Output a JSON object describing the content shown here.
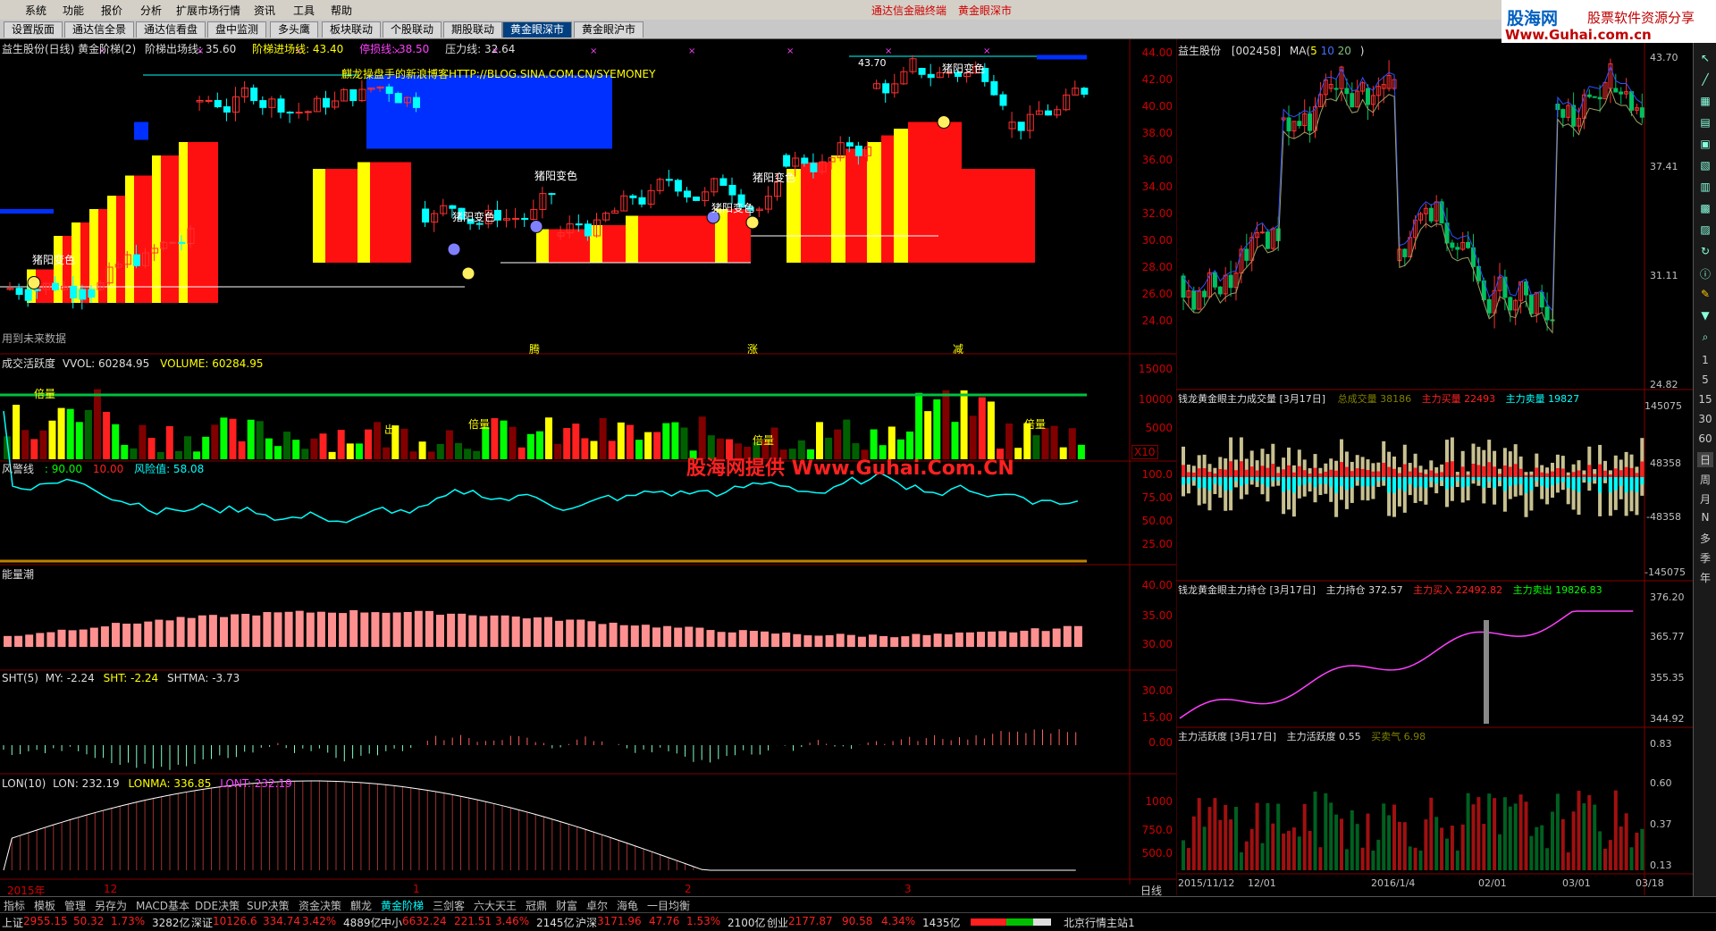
{
  "menu": {
    "items": [
      "系统",
      "功能",
      "报价",
      "分析",
      "扩展市场行情",
      "资讯",
      "工具",
      "帮助"
    ],
    "center_links": [
      "通达信金融终端",
      "黄金眼深市"
    ]
  },
  "brand": {
    "line1": "股海网",
    "line2": "股票软件资源分享",
    "line3": "Www.Guhai.com.cn"
  },
  "tabs": [
    "设置版面",
    "通达信全景",
    "通达信看盘",
    "盘中监测",
    "多头鹰",
    "板块联动",
    "个股联动",
    "期股联动",
    "黄金眼深市",
    "黄金眼沪市"
  ],
  "active_tab": "黄金眼深市",
  "main": {
    "title": "益生股份(日线) 黄金阶梯(2)",
    "exit_line": "阶梯出场线: 35.60",
    "entry_line": "阶梯进场线: 43.40",
    "stop_line": "停损线: 38.50",
    "pressure_line": "压力线: 32.64",
    "blog": "麒龙操盘手的新浪博客HTTP://BLOG.SINA.COM.CN/SYEMONEY",
    "future_note": "用到未来数据",
    "labels": [
      "猪阳变色",
      "猪阳变色",
      "猪阳变色",
      "猪阳变色",
      "猪阳变色",
      "猪阳变色"
    ],
    "high_label": "43.70",
    "markers": [
      "腾",
      "涨",
      "减"
    ],
    "axis": [
      "44.00",
      "42.00",
      "40.00",
      "38.00",
      "36.00",
      "34.00",
      "32.00",
      "30.00",
      "28.00",
      "26.00",
      "24.00"
    ]
  },
  "volume_panel": {
    "title": "成交活跃度",
    "vvol": "VVOL: 60284.95",
    "volume": "VOLUME: 60284.95",
    "axis": [
      "15000",
      "10000",
      "5000"
    ],
    "x10": "X10",
    "tags": [
      "倍量",
      "倍量",
      "倍量",
      "倍量",
      "出"
    ]
  },
  "risk_panel": {
    "title": "风警线",
    "v1": ": 90.00",
    "v2": "10.00",
    "risk": "风险值: 58.08",
    "axis": [
      "100.0",
      "75.00",
      "50.00",
      "25.00"
    ],
    "watermark": "股海网提供 Www.Guhai.Com.CN"
  },
  "energy_panel": {
    "title": "能量潮",
    "axis": [
      "40.00",
      "35.00",
      "30.00"
    ]
  },
  "sht_panel": {
    "title": "SHT(5)",
    "my": "MY: -2.24",
    "sht": "SHT: -2.24",
    "shtma": "SHTMA: -3.73",
    "axis": [
      "30.00",
      "15.00",
      "0.00"
    ]
  },
  "lon_panel": {
    "title": "LON(10)",
    "lon": "LON: 232.19",
    "lonma": "LONMA: 336.85",
    "lont": "LONT: 232.19",
    "axis": [
      "1000",
      "750.0",
      "500.0"
    ]
  },
  "date_axis": {
    "labels": [
      "2015年",
      "12",
      "1",
      "2",
      "3"
    ],
    "period": "日线"
  },
  "right_chart": {
    "name": "益生股份",
    "code": "[002458]",
    "ma": "MA(",
    "ma_values": [
      "5",
      "10",
      "20"
    ],
    "ma_close": ")",
    "axis": [
      "43.70",
      "37.41",
      "31.11",
      "24.82"
    ]
  },
  "right_vol": {
    "title": "钱龙黄金眼主力成交量 [3月17日]",
    "total": "总成交量",
    "total_val": "38186",
    "buy": "主力买量",
    "buy_val": "22493",
    "sell": "主力卖量",
    "sell_val": "19827",
    "axis": [
      "145075",
      "48358",
      "-48358",
      "-145075"
    ]
  },
  "right_hold": {
    "title": "钱龙黄金眼主力持仓 [3月17日]",
    "hold": "主力持仓 372.57",
    "buy": "主力买入",
    "buy_val": "22492.82",
    "sell": "主力卖出",
    "sell_val": "19826.83",
    "axis": [
      "376.20",
      "365.77",
      "355.35",
      "344.92"
    ]
  },
  "right_active": {
    "title": "主力活跃度 [3月17日]",
    "active": "主力活跃度 0.55",
    "mood": "买卖气 6.98",
    "axis": [
      "0.83",
      "0.60",
      "0.37",
      "0.13"
    ]
  },
  "right_dates": [
    "2015/11/12",
    "12/01",
    "2016/1/4",
    "02/01",
    "03/01",
    "03/18"
  ],
  "right_tools": [
    "1",
    "5",
    "15",
    "30",
    "60",
    "日",
    "周",
    "月",
    "N",
    "多",
    "季",
    "年"
  ],
  "bottom_tabs": [
    "指标",
    "模板",
    "管理",
    "另存为",
    "MACD基本",
    "DDE决策",
    "SUP决策",
    "资金决策",
    "麒龙",
    "黄金阶梯",
    "三剑客",
    "六大天王",
    "冠鼎",
    "财富",
    "卓尔",
    "海龟",
    "一目均衡"
  ],
  "active_bottom_tab": "黄金阶梯",
  "status": {
    "sh_label": "上证",
    "sh": "2955.15",
    "sh_chg": "50.32",
    "sh_pct": "1.73%",
    "sh_amt": "3282亿",
    "sz_label": "深证",
    "sz": "10126.6",
    "sz_chg": "334.74",
    "sz_pct": "3.42%",
    "sz_amt": "4889亿",
    "zx_label": "中小",
    "zx": "6632.24",
    "zx_chg": "221.51",
    "zx_pct": "3.46%",
    "zx_amt": "2145亿",
    "hs_label": "沪深",
    "hs": "3171.96",
    "hs_chg": "47.76",
    "hs_pct": "1.53%",
    "hs_amt": "2100亿",
    "cy_label": "创业",
    "cy": "2177.87",
    "cy_chg": "90.58",
    "cy_pct": "4.34%",
    "cy_amt": "1435亿",
    "server": "北京行情主站1"
  },
  "colors": {
    "up": "#ff2020",
    "down": "#00e0e0",
    "blue": "#0050ff",
    "yellow": "#ffff00",
    "green": "#00ff00",
    "axis": "#c00000"
  }
}
